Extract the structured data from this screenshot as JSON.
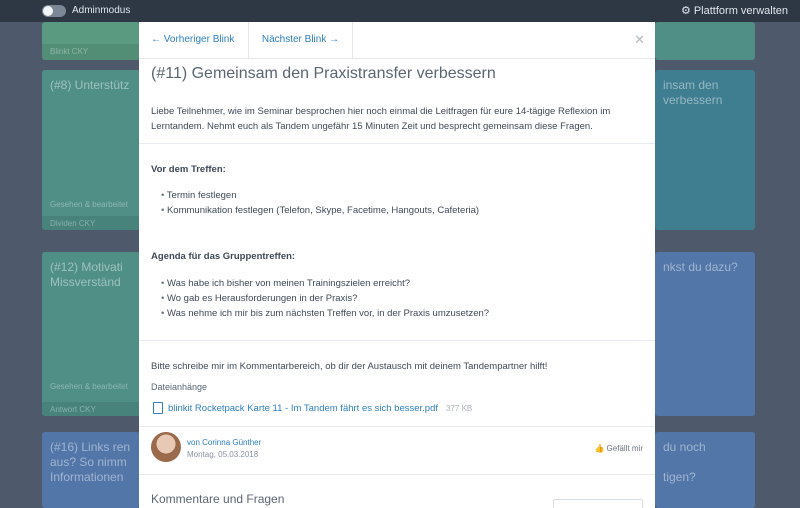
{
  "topbar": {
    "admin_label": "Adminmodus",
    "platform_label": "Plattform verwalten",
    "platform_icon": "gear-icon"
  },
  "background": {
    "card_top_label": "Blinkt  CKY",
    "card_8_title": "(#8) Unterstütz",
    "card_8_meta": "Gesehen & bearbeitet",
    "card_8_foot": "Dividen  CKY",
    "card_12_title": "(#12) Motivati\nMissverständ",
    "card_12_meta": "Gesehen & bearbeitet",
    "card_12_foot": "Antwort  CKY",
    "card_16_title": "(#16) Links ren\naus? So nimm\nInformationen",
    "right_1_title": "insam den\nverbessern",
    "right_2_title": "nkst du dazu?",
    "right_3_title": "du noch\n\ntigen?"
  },
  "modal": {
    "prev_label": "Vorheriger Blink",
    "next_label": "Nächster Blink",
    "close_icon": "close-icon",
    "title": "(#11) Gemeinsam den Praxistransfer verbessern",
    "intro": "Liebe Teilnehmer, wie im Seminar besprochen hier noch einmal die Leitfragen für eure 14-tägige Reflexion im Lerntandem. Nehmt euch als Tandem ungefähr 15 Minuten Zeit und besprecht gemeinsam diese Fragen.",
    "section1_heading": "Vor dem Treffen:",
    "section1_items": [
      "Termin festlegen",
      "Kommunikation festlegen (Telefon, Skype, Facetime, Hangouts, Cafeteria)"
    ],
    "section2_heading": "Agenda für das Gruppentreffen:",
    "section2_items": [
      "Was habe ich bisher von meinen Trainingszielen erreicht?",
      "Wo gab es Herausforderungen in der Praxis?",
      "Was nehme ich mir bis zum nächsten Treffen vor, in der Praxis umzusetzen?"
    ],
    "closing": "Bitte schreibe mir im Kommentarbereich, ob dir der Austausch mit deinem Tandempartner hilft!",
    "attachments_label": "Dateianhänge",
    "attachment": {
      "name": "blinkit Rocketpack Karte 11 - Im Tandem fährt es sich besser.pdf",
      "size": "377 KB"
    },
    "author": {
      "by": "von Corinna Günther",
      "date": "Montag, 05.03.2018"
    },
    "like_label": "Gefällt mir",
    "comments_title": "Kommentare und Fragen"
  }
}
